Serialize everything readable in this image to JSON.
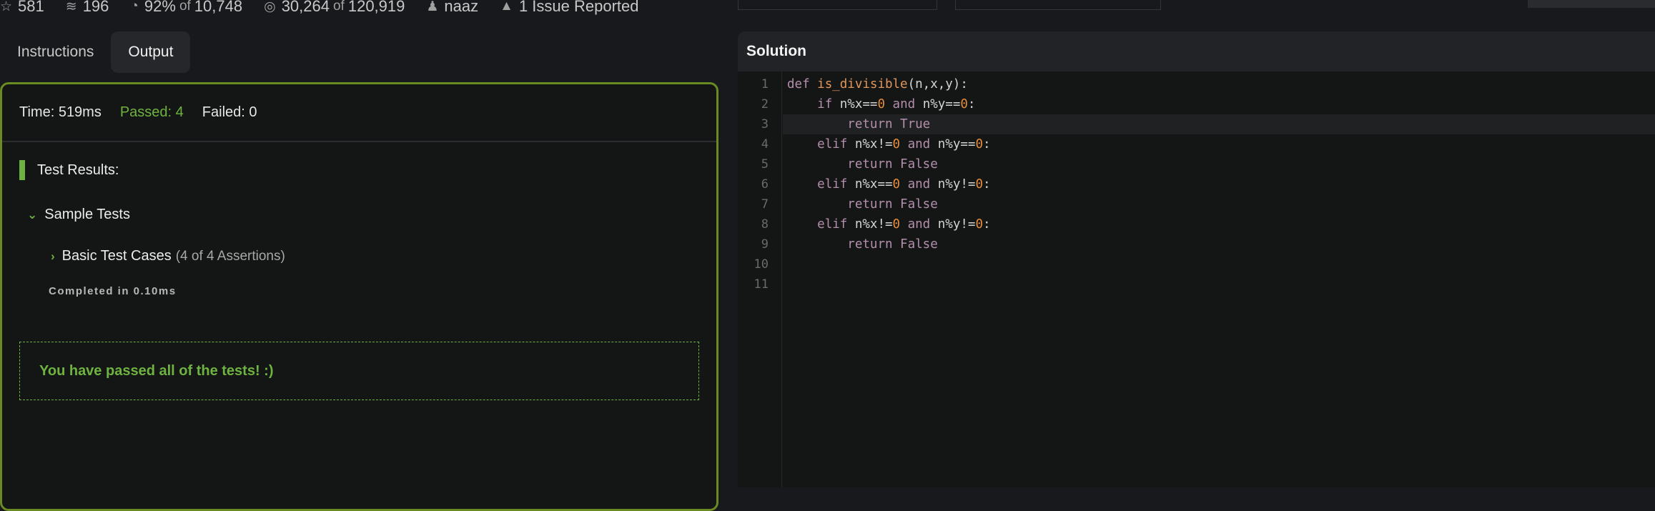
{
  "stats": [
    {
      "icon": "star-icon",
      "glyph": "☆",
      "value": "581"
    },
    {
      "icon": "layers-icon",
      "glyph": "≋",
      "value": "196"
    },
    {
      "icon": "gauge-icon",
      "glyph": "◔",
      "value": "92%",
      "of": "of",
      "total": "10,748"
    },
    {
      "icon": "target-icon",
      "glyph": "◎",
      "value": "30,264",
      "of": "of",
      "total": "120,919"
    },
    {
      "icon": "user-icon",
      "glyph": "♟",
      "value": "naaz"
    },
    {
      "icon": "warning-icon",
      "glyph": "▲",
      "value": "1 Issue Reported"
    }
  ],
  "tabs": {
    "instructions": "Instructions",
    "output": "Output"
  },
  "output": {
    "time": "Time: 519ms",
    "passed": "Passed: 4",
    "failed": "Failed: 0",
    "test_results": "Test Results:",
    "sample_tests": "Sample Tests",
    "basic": "Basic Test Cases",
    "assertions": "(4 of 4 Assertions)",
    "completed": "Completed in 0.10ms",
    "passed_all": "You have passed all of the tests! :)"
  },
  "solution": {
    "title": "Solution",
    "highlight_line": 3,
    "lines": [
      [
        [
          "kw",
          "def "
        ],
        [
          "fn",
          "is_divisible"
        ],
        [
          "tx",
          "(n,x,y):"
        ]
      ],
      [
        [
          "tx",
          "    "
        ],
        [
          "kw",
          "if "
        ],
        [
          "tx",
          "n%x=="
        ],
        [
          "num",
          "0"
        ],
        [
          "kw",
          " and "
        ],
        [
          "tx",
          "n%y=="
        ],
        [
          "num",
          "0"
        ],
        [
          "tx",
          ":"
        ]
      ],
      [
        [
          "tx",
          "        "
        ],
        [
          "kw",
          "return True"
        ]
      ],
      [
        [
          "tx",
          "    "
        ],
        [
          "kw",
          "elif "
        ],
        [
          "tx",
          "n%x!="
        ],
        [
          "num",
          "0"
        ],
        [
          "kw",
          " and "
        ],
        [
          "tx",
          "n%y=="
        ],
        [
          "num",
          "0"
        ],
        [
          "tx",
          ":"
        ]
      ],
      [
        [
          "tx",
          "        "
        ],
        [
          "kw",
          "return False"
        ]
      ],
      [
        [
          "tx",
          "    "
        ],
        [
          "kw",
          "elif "
        ],
        [
          "tx",
          "n%x=="
        ],
        [
          "num",
          "0"
        ],
        [
          "kw",
          " and "
        ],
        [
          "tx",
          "n%y!="
        ],
        [
          "num",
          "0"
        ],
        [
          "tx",
          ":"
        ]
      ],
      [
        [
          "tx",
          "        "
        ],
        [
          "kw",
          "return False"
        ]
      ],
      [
        [
          "tx",
          "    "
        ],
        [
          "kw",
          "elif "
        ],
        [
          "tx",
          "n%x!="
        ],
        [
          "num",
          "0"
        ],
        [
          "kw",
          " and "
        ],
        [
          "tx",
          "n%y!="
        ],
        [
          "num",
          "0"
        ],
        [
          "tx",
          ":"
        ]
      ],
      [
        [
          "tx",
          "        "
        ],
        [
          "kw",
          "return False"
        ]
      ],
      [],
      []
    ]
  }
}
